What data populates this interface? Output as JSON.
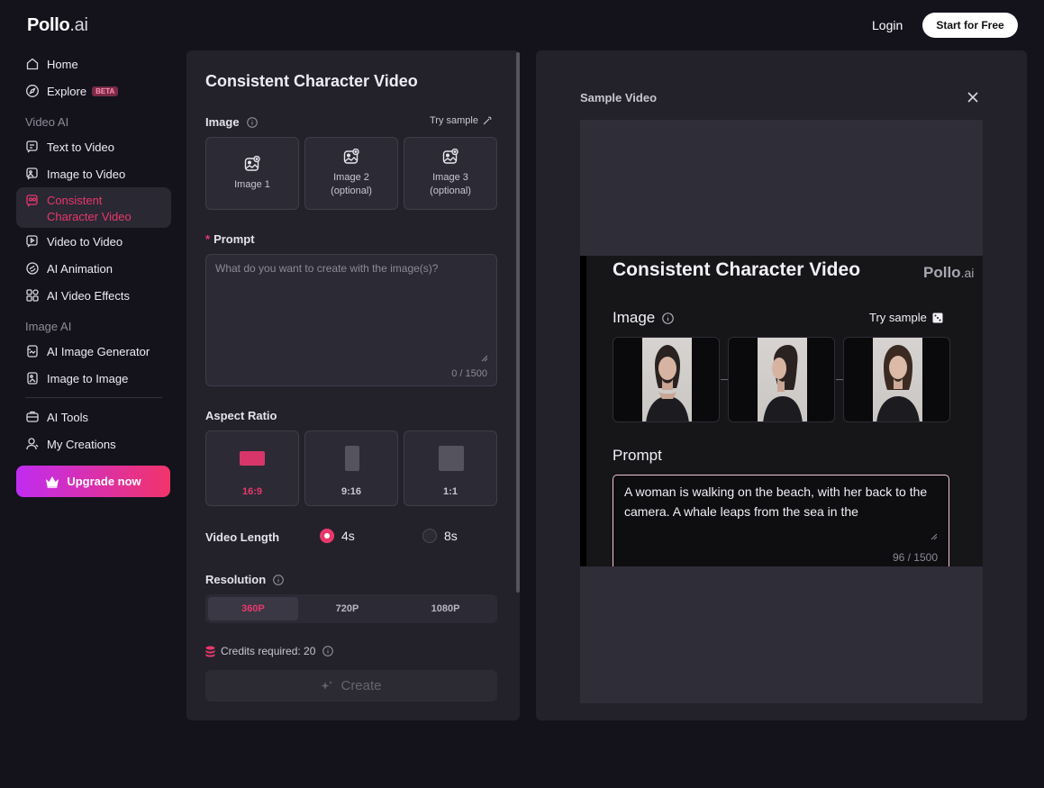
{
  "header": {
    "logo_main": "Pollo",
    "logo_suffix": ".ai",
    "login_label": "Login",
    "start_label": "Start for Free"
  },
  "sidebar": {
    "home": "Home",
    "explore": "Explore",
    "explore_badge": "BETA",
    "section_video": "Video AI",
    "text_to_video": "Text to Video",
    "image_to_video": "Image to Video",
    "consistent_character": "Consistent Character Video",
    "video_to_video": "Video to Video",
    "ai_animation": "AI Animation",
    "ai_video_effects": "AI Video Effects",
    "section_image": "Image AI",
    "ai_image_generator": "AI Image Generator",
    "image_to_image": "Image to Image",
    "ai_tools": "AI Tools",
    "my_creations": "My Creations",
    "upgrade": "Upgrade now"
  },
  "form": {
    "title": "Consistent Character Video",
    "image_label": "Image",
    "try_sample": "Try sample",
    "slots": [
      {
        "line1": "Image 1",
        "line2": ""
      },
      {
        "line1": "Image 2",
        "line2": "(optional)"
      },
      {
        "line1": "Image 3",
        "line2": "(optional)"
      }
    ],
    "prompt_required": "*",
    "prompt_label": "Prompt",
    "prompt_placeholder": "What do you want to create with the image(s)?",
    "prompt_count": "0 / 1500",
    "aspect_label": "Aspect Ratio",
    "ratios": [
      "16:9",
      "9:16",
      "1:1"
    ],
    "selected_ratio": "16:9",
    "length_label": "Video Length",
    "lengths": [
      "4s",
      "8s"
    ],
    "selected_length": "4s",
    "resolution_label": "Resolution",
    "resolutions": [
      "360P",
      "720P",
      "1080P"
    ],
    "selected_resolution": "360P",
    "credits": "Credits required: 20",
    "create_label": "Create"
  },
  "sample": {
    "title": "Sample Video",
    "video_title": "Consistent Character Video",
    "video_logo_main": "Pollo",
    "video_logo_suffix": ".ai",
    "video_image_label": "Image",
    "video_try_sample": "Try sample",
    "video_prompt_label": "Prompt",
    "video_prompt_text": "A woman is walking on the beach, with her back to the camera. A whale leaps from the sea in the",
    "video_prompt_count": "96 / 1500"
  },
  "colors": {
    "accent": "#e8386b",
    "background": "#14131c",
    "panel": "#23222b",
    "upgrade_gradient_start": "#c02cf0",
    "upgrade_gradient_end": "#f2346a"
  }
}
